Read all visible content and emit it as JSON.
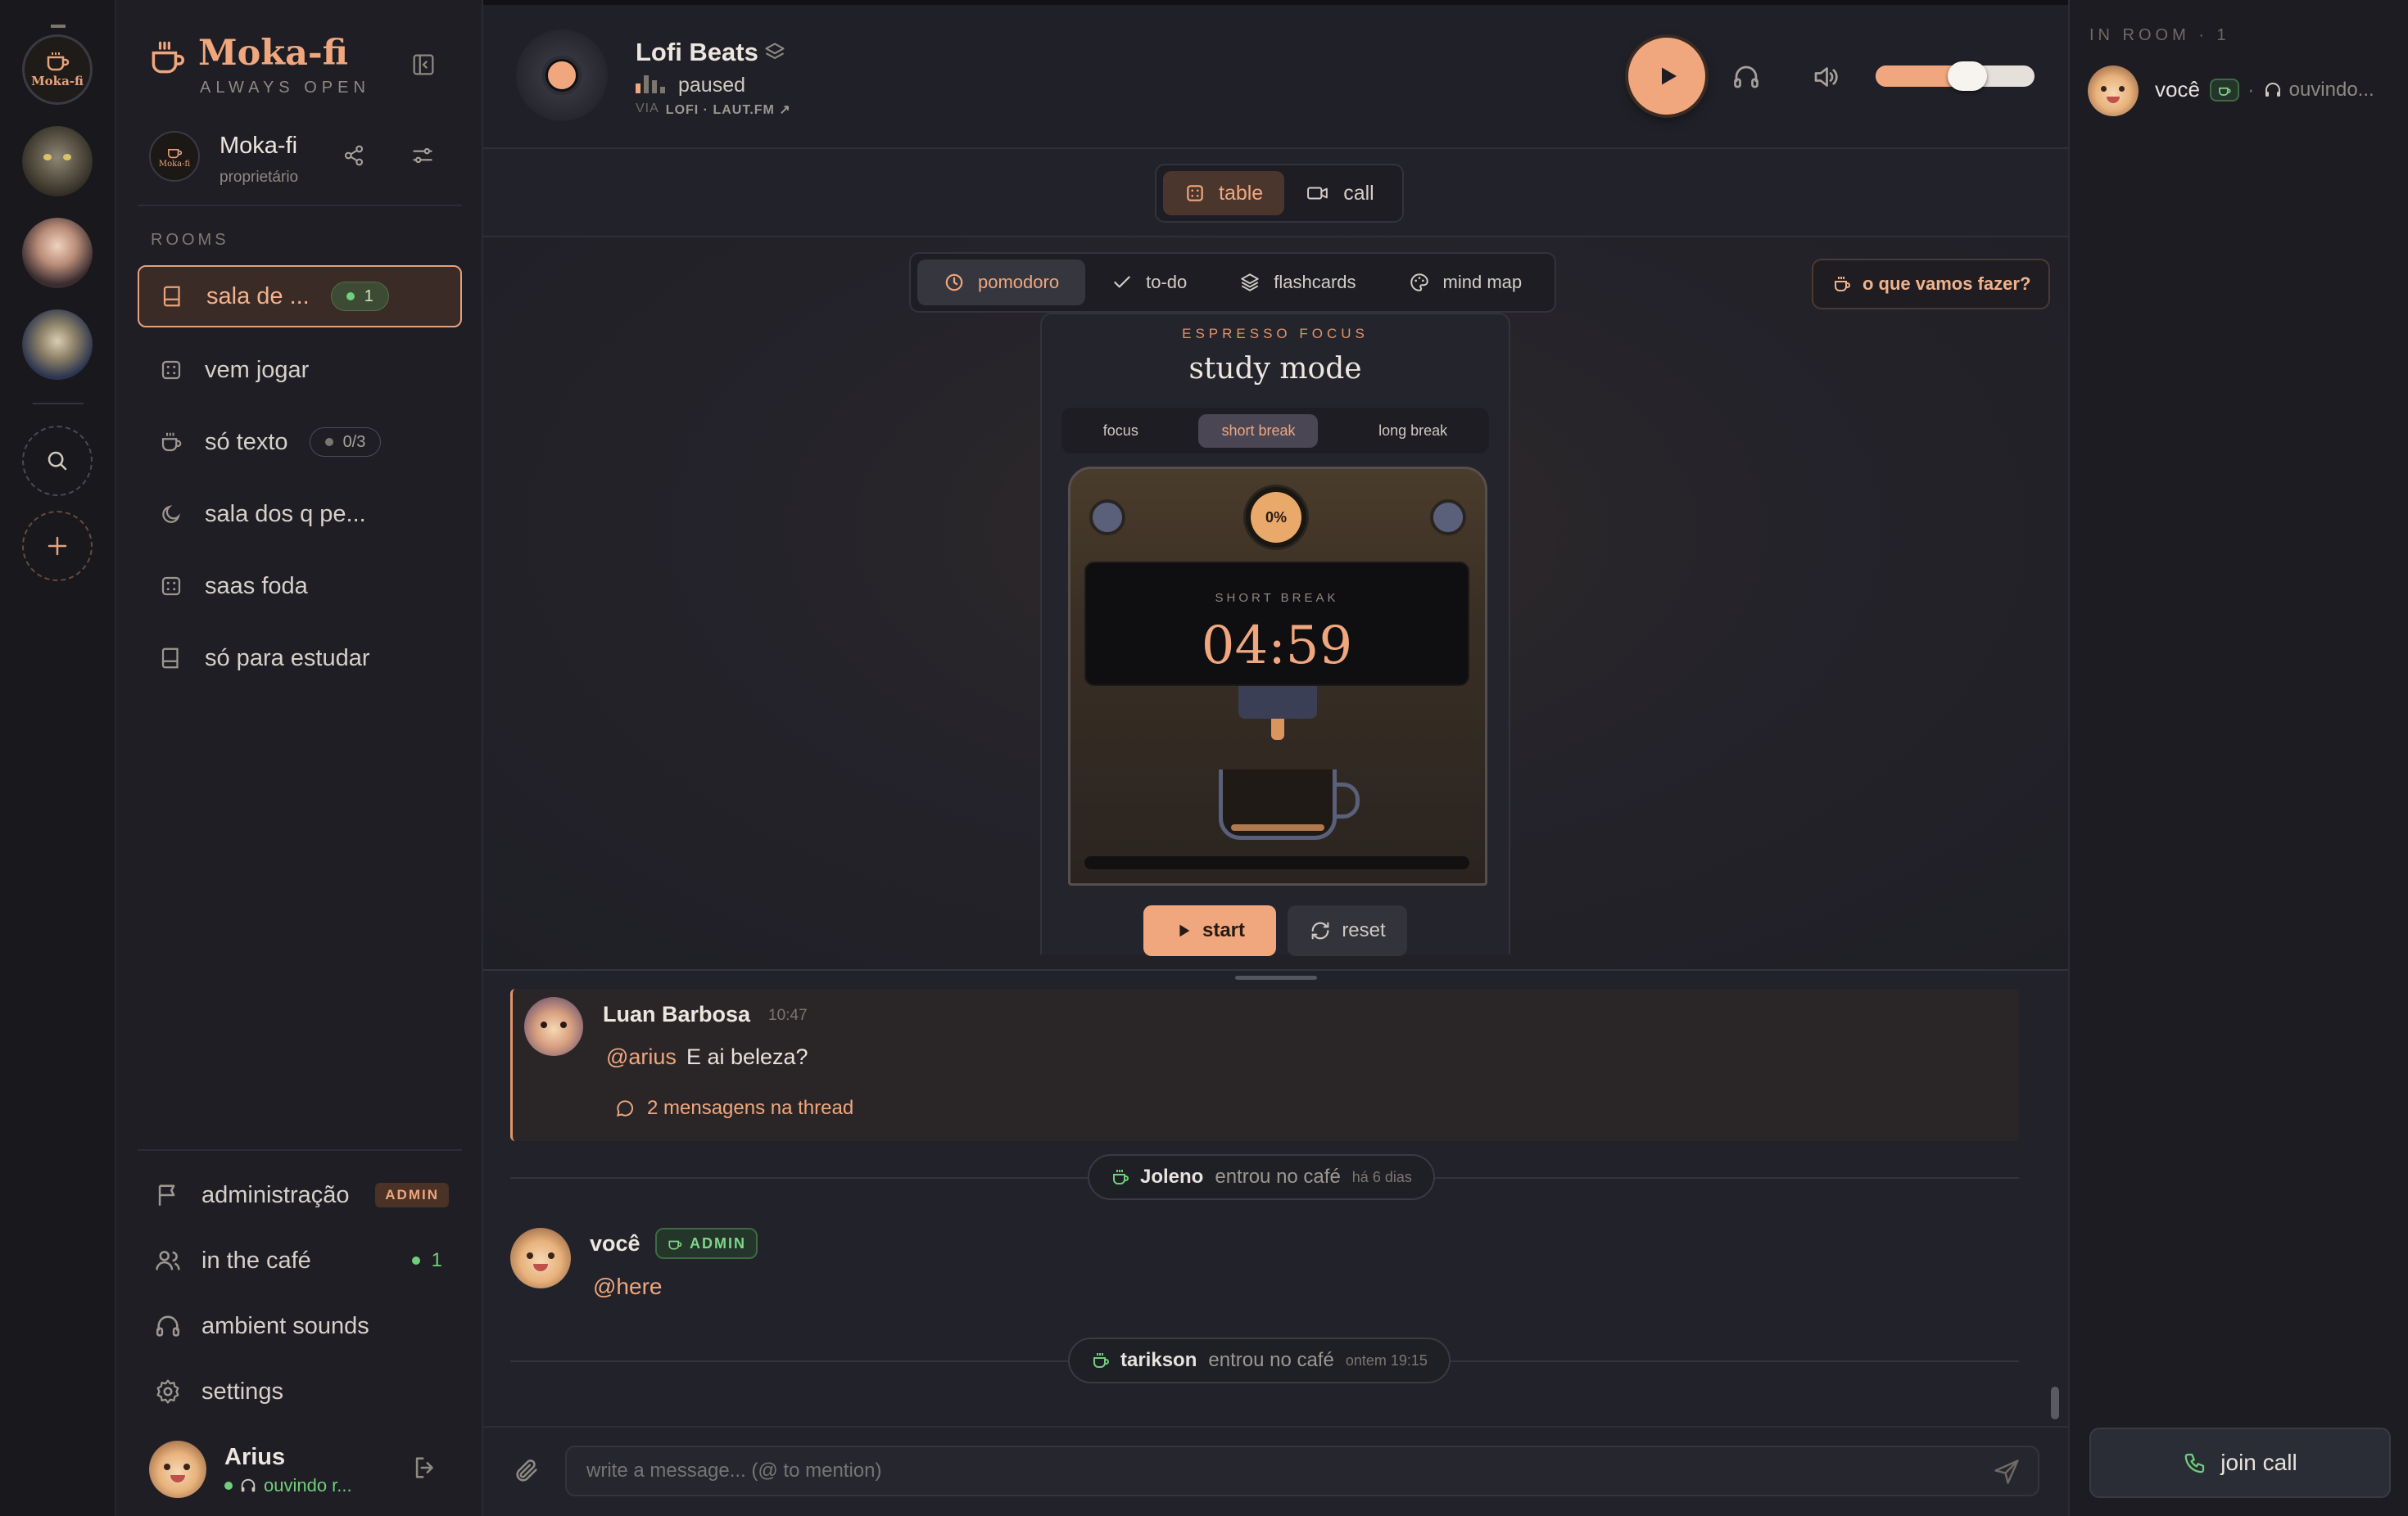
{
  "servers": {
    "active_logo_text": "Moka-fi"
  },
  "sidebar": {
    "app_name": "Moka-fi",
    "tagline": "ALWAYS OPEN",
    "server_name": "Moka-fi",
    "server_role": "proprietário",
    "server_logo_text": "Moka-fi",
    "rooms_heading": "ROOMS",
    "rooms": [
      {
        "label": "sala de ...",
        "icon": "book-icon",
        "badge": "1",
        "active": true
      },
      {
        "label": "vem jogar",
        "icon": "dice-icon"
      },
      {
        "label": "só texto",
        "icon": "coffee-icon",
        "badge": "0/3"
      },
      {
        "label": "sala dos q pe...",
        "icon": "moon-icon"
      },
      {
        "label": "saas foda",
        "icon": "dice-icon"
      },
      {
        "label": "só para estudar",
        "icon": "book-icon"
      }
    ],
    "nav": [
      {
        "label": "administração",
        "icon": "flag-icon",
        "tag": "ADMIN"
      },
      {
        "label": "in the café",
        "icon": "users-icon",
        "count": "1"
      },
      {
        "label": "ambient sounds",
        "icon": "headphones-icon"
      },
      {
        "label": "settings",
        "icon": "gear-icon"
      }
    ],
    "user": {
      "name": "Arius",
      "status": "ouvindo r..."
    }
  },
  "player": {
    "title": "Lofi Beats",
    "state": "paused",
    "source_prefix": "VIA",
    "source": "LOFI · LAUT.FM ↗",
    "volume": 0.6
  },
  "view_tabs": [
    {
      "label": "table",
      "active": true
    },
    {
      "label": "call"
    }
  ],
  "tools": [
    {
      "label": "pomodoro",
      "active": true
    },
    {
      "label": "to-do"
    },
    {
      "label": "flashcards"
    },
    {
      "label": "mind map"
    }
  ],
  "cta": {
    "label": "o que vamos fazer?"
  },
  "pomodoro": {
    "eyebrow": "ESPRESSO FOCUS",
    "title": "study mode",
    "modes": [
      {
        "label": "focus"
      },
      {
        "label": "short break",
        "active": true
      },
      {
        "label": "long break"
      }
    ],
    "progress": "0%",
    "screen_label": "SHORT BREAK",
    "time": "04:59",
    "start": "start",
    "reset": "reset"
  },
  "chat": {
    "messages": [
      {
        "author": "Luan Barbosa",
        "time": "10:47",
        "mention": "@arius",
        "text": "E ai beleza?",
        "thread": "2 mensagens na thread"
      },
      {
        "author": "você",
        "tag": "ADMIN",
        "text": "@here"
      }
    ],
    "system": [
      {
        "name": "Joleno",
        "text": "entrou no café",
        "when": "há 6 dias"
      },
      {
        "name": "tarikson",
        "text": "entrou no café",
        "when": "ontem 19:15"
      }
    ],
    "placeholder": "write a message... (@ to mention)"
  },
  "right_panel": {
    "heading": "IN ROOM · 1",
    "members": [
      {
        "name": "você",
        "status": "ouvindo..."
      }
    ],
    "join_call": "join call"
  },
  "colors": {
    "accent": "#f0a77e",
    "online": "#6fcf7c",
    "background": "#1d1d24"
  }
}
